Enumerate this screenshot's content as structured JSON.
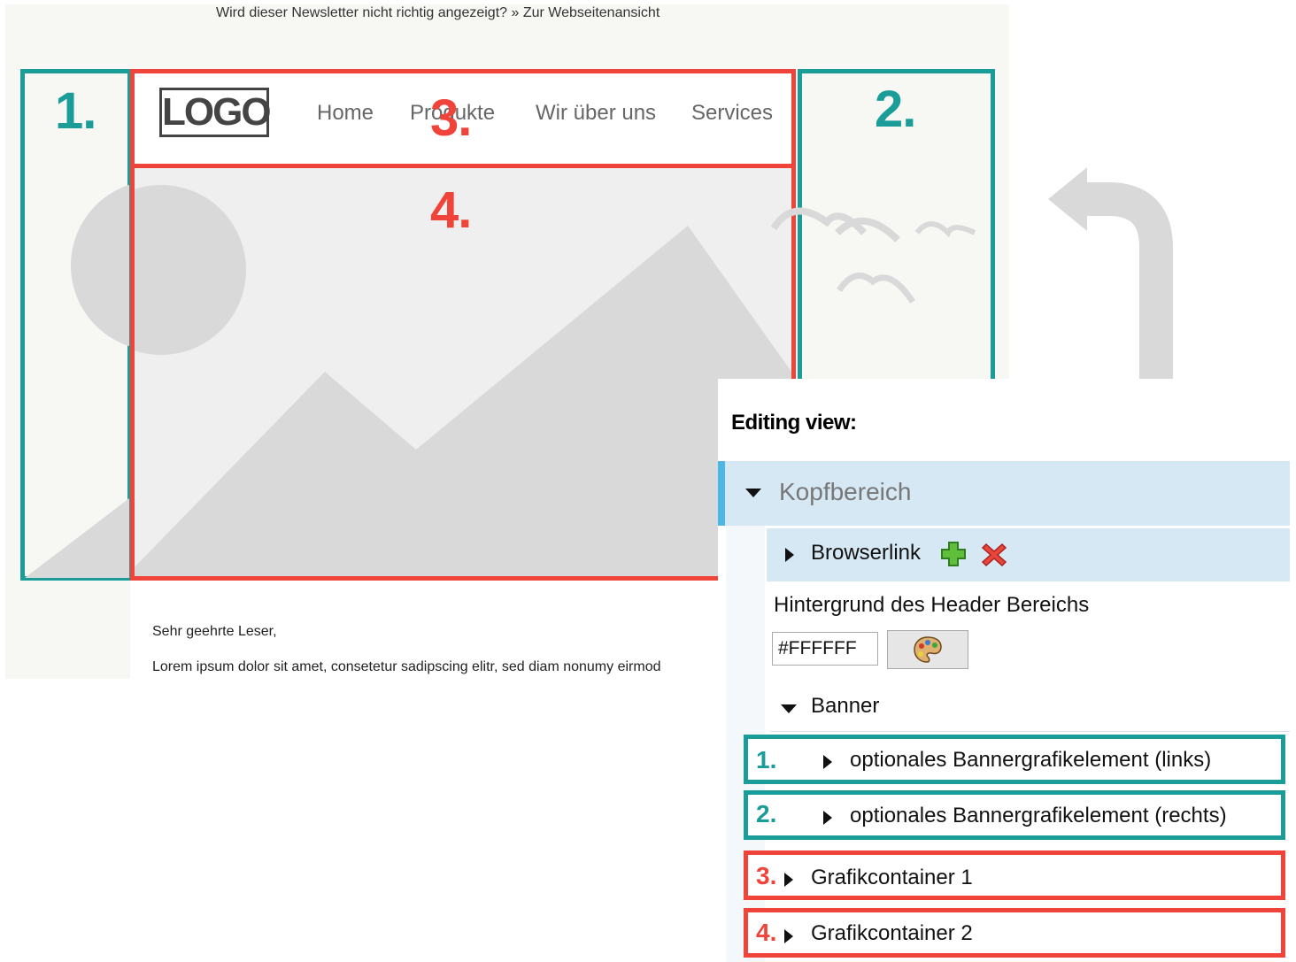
{
  "preview": {
    "browser_line": "Wird dieser Newsletter nicht richtig angezeigt? » Zur Webseitenansicht",
    "logo_text": "LOGO",
    "nav": [
      "Home",
      "Produkte",
      "Wir über uns",
      "Services"
    ],
    "zone_numbers": [
      "1.",
      "2.",
      "3.",
      "4."
    ],
    "greeting": "Sehr geehrte Leser,",
    "lorem": "Lorem ipsum dolor sit amet, consetetur sadipscing elitr, sed diam nonumy eirmod"
  },
  "editor": {
    "title": "Editing view:",
    "section": "Kopfbereich",
    "browserlink": "Browserlink",
    "bg_label": "Hintergrund des Header Bereichs",
    "color_value": "#FFFFFF",
    "banner": "Banner",
    "items": [
      {
        "num": "1.",
        "label": "optionales Bannergrafikelement (links)"
      },
      {
        "num": "2.",
        "label": "optionales Bannergrafikelement (rechts)"
      },
      {
        "num": "3.",
        "label": "Grafikcontainer 1"
      },
      {
        "num": "4.",
        "label": "Grafikcontainer 2"
      }
    ]
  },
  "colors": {
    "teal": "#1a9d99",
    "red": "#f0433a",
    "selection_blue": "#d6e8f4",
    "accent_blue": "#4cb6e4"
  },
  "icons": [
    "plus-icon",
    "close-icon",
    "palette-icon",
    "caret-down-icon",
    "caret-right-icon",
    "return-arrow-icon"
  ]
}
